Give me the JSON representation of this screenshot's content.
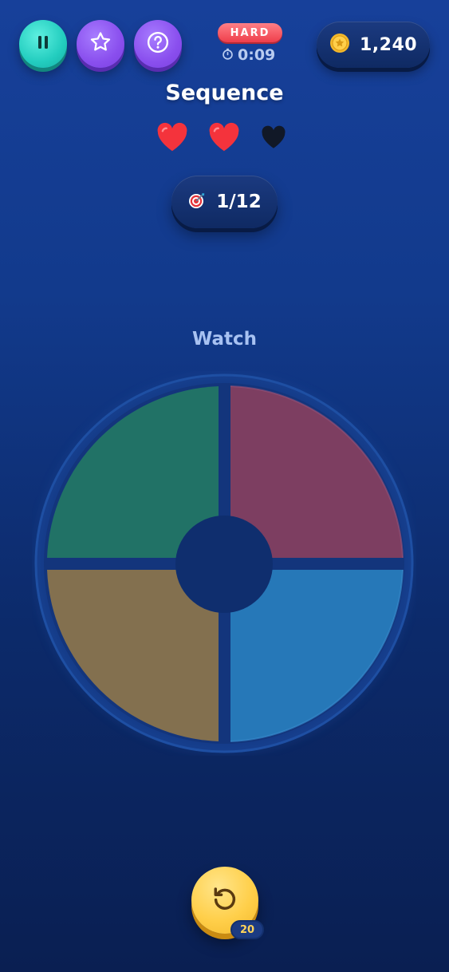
{
  "header": {
    "pause_icon": "pause-icon",
    "star_icon": "star-icon",
    "help_icon": "question-mark-icon",
    "difficulty": "HARD",
    "timer_icon": "stopwatch-icon",
    "timer": "0:09",
    "coin_icon": "gold-coin-icon",
    "coins": "1,240"
  },
  "game": {
    "title": "Sequence",
    "lives_total": 3,
    "lives_remaining": 2,
    "progress_icon": "target-dart-icon",
    "progress": "1/12",
    "status": "Watch",
    "pads": [
      {
        "name": "green",
        "color": "#217266"
      },
      {
        "name": "red",
        "color": "#7d3e61"
      },
      {
        "name": "yellow",
        "color": "#83704f"
      },
      {
        "name": "blue",
        "color": "#2678b8"
      }
    ]
  },
  "footer": {
    "replay_icon": "replay-icon",
    "replay_cost": "20"
  },
  "colors": {
    "heart_full": "#f4333c",
    "heart_empty": "#111827",
    "accent_teal": "#23cdbf",
    "accent_purple": "#8a4fee",
    "accent_gold": "#ffcf4a",
    "difficulty_red": "#ef3e4b"
  }
}
